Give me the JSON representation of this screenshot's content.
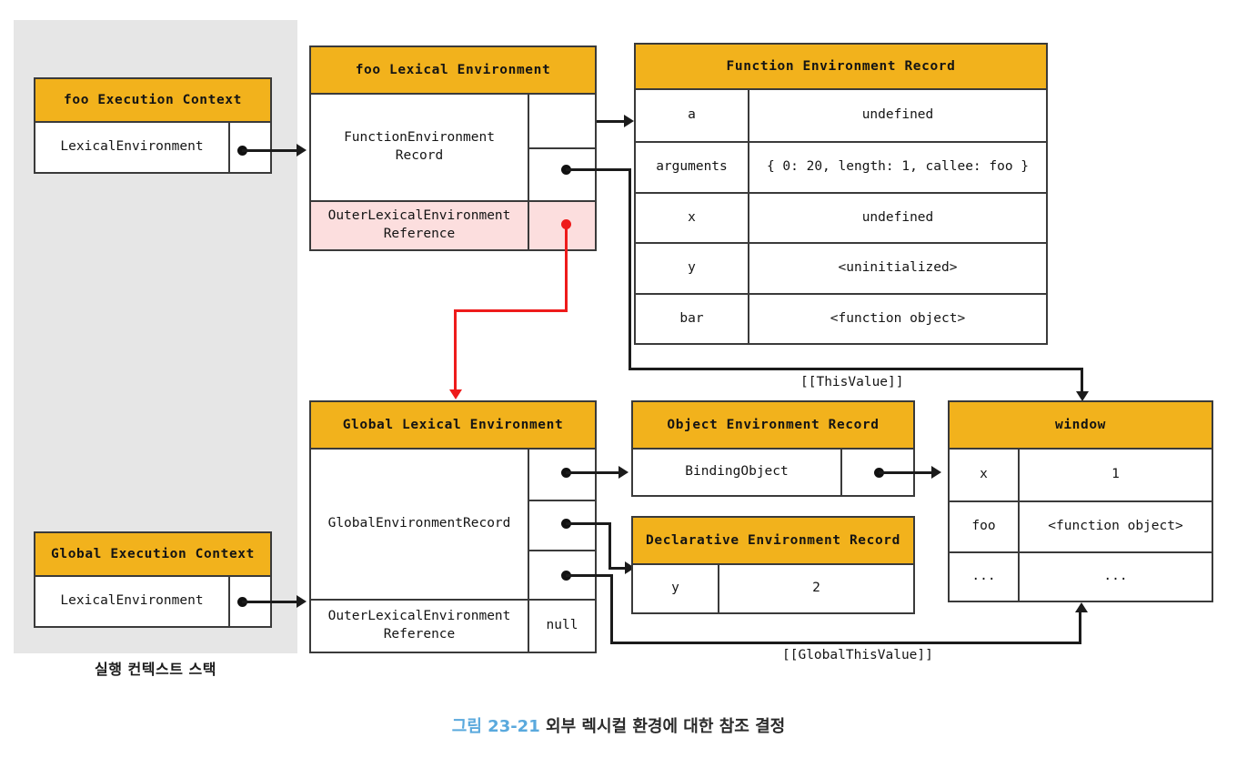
{
  "stack_panel": {
    "caption": "실행 컨텍스트 스택"
  },
  "foo_execution_context": {
    "title": "foo Execution Context",
    "rows": [
      {
        "label": "LexicalEnvironment",
        "value": ""
      }
    ]
  },
  "global_execution_context": {
    "title": "Global Execution Context",
    "rows": [
      {
        "label": "LexicalEnvironment",
        "value": ""
      }
    ]
  },
  "foo_lexical_environment": {
    "title": "foo Lexical Environment",
    "record_label": "FunctionEnvironment\nRecord",
    "outer_label": "OuterLexicalEnvironment\nReference",
    "outer_value": ""
  },
  "function_environment_record": {
    "title": "Function Environment Record",
    "rows": [
      {
        "key": "a",
        "value": "undefined"
      },
      {
        "key": "arguments",
        "value": "{ 0: 20, length: 1, callee: foo }"
      },
      {
        "key": "x",
        "value": "undefined"
      },
      {
        "key": "y",
        "value": "<uninitialized>"
      },
      {
        "key": "bar",
        "value": "<function object>"
      }
    ]
  },
  "global_lexical_environment": {
    "title": "Global Lexical Environment",
    "record_label": "GlobalEnvironmentRecord",
    "outer_label": "OuterLexicalEnvironment\nReference",
    "outer_value": "null"
  },
  "object_environment_record": {
    "title": "Object Environment Record",
    "rows": [
      {
        "key": "BindingObject",
        "value": ""
      }
    ]
  },
  "declarative_environment_record": {
    "title": "Declarative Environment Record",
    "rows": [
      {
        "key": "y",
        "value": "2"
      }
    ]
  },
  "window": {
    "title": "window",
    "rows": [
      {
        "key": "x",
        "value": "1"
      },
      {
        "key": "foo",
        "value": "<function object>"
      },
      {
        "key": "...",
        "value": "..."
      }
    ]
  },
  "edges": {
    "this_value": "[[ThisValue]]",
    "global_this_value": "[[GlobalThisValue]]"
  },
  "caption": {
    "number": "그림 23-21",
    "text": "외부 렉시컬 환경에 대한 참조 결정"
  },
  "colors": {
    "header_yellow": "#f2b21c",
    "panel_gray": "#e6e6e6",
    "highlight_pink": "#fcdede",
    "red_arrow": "#ee1b1b",
    "caption_blue": "#5aa9dd",
    "border": "#3a3a3a"
  }
}
